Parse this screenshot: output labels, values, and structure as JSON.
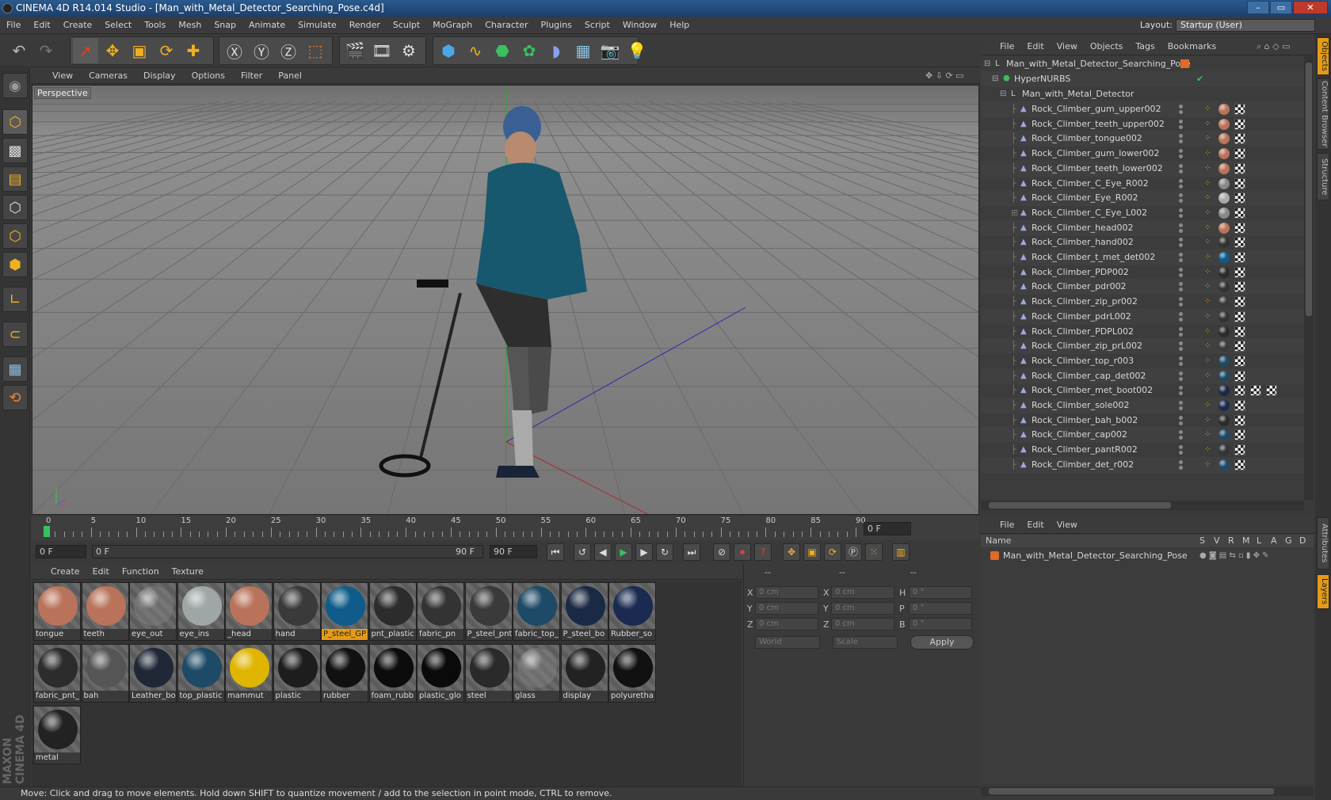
{
  "window": {
    "title": "CINEMA 4D R14.014 Studio - [Man_with_Metal_Detector_Searching_Pose.c4d]",
    "minimize": "–",
    "maximize": "▭",
    "close": "✕"
  },
  "menubar": {
    "items": [
      "File",
      "Edit",
      "Create",
      "Select",
      "Tools",
      "Mesh",
      "Snap",
      "Animate",
      "Simulate",
      "Render",
      "Sculpt",
      "MoGraph",
      "Character",
      "Plugins",
      "Script",
      "Window",
      "Help"
    ],
    "layout_label": "Layout:",
    "layout_value": "Startup (User)"
  },
  "viewport": {
    "menu": [
      "View",
      "Cameras",
      "Display",
      "Options",
      "Filter",
      "Panel"
    ],
    "label": "Perspective"
  },
  "timeline": {
    "ticks": [
      "0",
      "5",
      "10",
      "15",
      "20",
      "25",
      "30",
      "35",
      "40",
      "45",
      "50",
      "55",
      "60",
      "65",
      "70",
      "75",
      "80",
      "85",
      "90"
    ],
    "current_frame_field": "0 F",
    "start_field": "0 F",
    "range_start": "0 F",
    "range_end": "90 F",
    "end_field": "90 F"
  },
  "materials": {
    "menu": [
      "Create",
      "Edit",
      "Function",
      "Texture"
    ],
    "items": [
      {
        "name": "tongue",
        "color": "#b9735a"
      },
      {
        "name": "teeth",
        "color": "#b9735a"
      },
      {
        "name": "eye_out",
        "color": "transparent"
      },
      {
        "name": "eye_ins",
        "color": "#9ea6a6"
      },
      {
        "name": "_head",
        "color": "#b9735a"
      },
      {
        "name": "hand",
        "color": "#3a3a3a"
      },
      {
        "name": "P_steel_GP",
        "color": "#0f5c8a"
      },
      {
        "name": "pnt_plastic",
        "color": "#2c2c2c"
      },
      {
        "name": "fabric_pn",
        "color": "#333"
      },
      {
        "name": "P_steel_pnt",
        "color": "#3a3a3a"
      },
      {
        "name": "fabric_top_",
        "color": "#1d4a66"
      },
      {
        "name": "P_steel_bo",
        "color": "#1a2a44"
      },
      {
        "name": "Rubber_so",
        "color": "#1b2a50"
      },
      {
        "name": "fabric_pnt_",
        "color": "#2c2c2c"
      },
      {
        "name": "bah",
        "color": "#555"
      },
      {
        "name": "Leather_bo",
        "color": "#202838"
      },
      {
        "name": "top_plastic",
        "color": "#1d4a66"
      },
      {
        "name": "mammut",
        "color": "#e0b500"
      },
      {
        "name": "plastic",
        "color": "#1d1d1d"
      },
      {
        "name": "rubber",
        "color": "#111"
      },
      {
        "name": "foam_rubb",
        "color": "#0c0c0c"
      },
      {
        "name": "plastic_glo",
        "color": "#0a0a0a"
      },
      {
        "name": "steel",
        "color": "#2a2a2a"
      },
      {
        "name": "glass",
        "color": "transparent"
      },
      {
        "name": "display",
        "color": "#222"
      },
      {
        "name": "polyuretha",
        "color": "#111"
      },
      {
        "name": "metal",
        "color": "#222"
      }
    ],
    "selected": "P_steel_GP"
  },
  "coords": {
    "header": [
      "--",
      "--",
      "--"
    ],
    "rows": [
      {
        "a": "X",
        "av": "0 cm",
        "b": "X",
        "bv": "0 cm",
        "c": "H",
        "cv": "0 °"
      },
      {
        "a": "Y",
        "av": "0 cm",
        "b": "Y",
        "bv": "0 cm",
        "c": "P",
        "cv": "0 °"
      },
      {
        "a": "Z",
        "av": "0 cm",
        "b": "Z",
        "bv": "0 cm",
        "c": "B",
        "cv": "0 °"
      }
    ],
    "world": "World",
    "scale": "Scale",
    "apply": "Apply"
  },
  "status": "Move: Click and drag to move elements. Hold down SHIFT to quantize movement / add to the selection in point mode, CTRL to remove.",
  "object_manager": {
    "menu": [
      "File",
      "Edit",
      "View",
      "Objects",
      "Tags",
      "Bookmarks"
    ],
    "root": "Man_with_Metal_Detector_Searching_Pose",
    "hypernurbs": "HyperNURBS",
    "group": "Man_with_Metal_Detector",
    "objects": [
      "Rock_Climber_gum_upper002",
      "Rock_Climber_teeth_upper002",
      "Rock_Climber_tongue002",
      "Rock_Climber_gum_lower002",
      "Rock_Climber_teeth_lower002",
      "Rock_Climber_C_Eye_R002",
      "Rock_Climber_Eye_R002",
      "Rock_Climber_C_Eye_L002",
      "Rock_Climber_head002",
      "Rock_Climber_hand002",
      "Rock_Climber_t_met_det002",
      "Rock_Climber_PDP002",
      "Rock_Climber_pdr002",
      "Rock_Climber_zip_pr002",
      "Rock_Climber_pdrL002",
      "Rock_Climber_PDPL002",
      "Rock_Climber_zip_prL002",
      "Rock_Climber_top_r003",
      "Rock_Climber_cap_det002",
      "Rock_Climber_met_boot002",
      "Rock_Climber_sole002",
      "Rock_Climber_bah_b002",
      "Rock_Climber_cap002",
      "Rock_Climber_pantR002",
      "Rock_Climber_det_r002"
    ],
    "tag_colors": [
      "#b9735a",
      "#b9735a",
      "#b9735a",
      "#b9735a",
      "#b9735a",
      "#888",
      "#aaa",
      "#888",
      "#b9735a",
      "#333",
      "#0f5c8a",
      "#2c2c2c",
      "#333",
      "#3a3a3a",
      "#333",
      "#2c2c2c",
      "#3a3a3a",
      "#1d4a66",
      "#1d4a66",
      "#1a2a44",
      "#1b2a50",
      "#2c2c2c",
      "#1d4a66",
      "#333",
      "#1d4a66"
    ]
  },
  "layer_manager": {
    "menu": [
      "File",
      "Edit",
      "View"
    ],
    "columns": [
      "Name",
      "S",
      "V",
      "R",
      "M",
      "L",
      "A",
      "G",
      "D"
    ],
    "layer": "Man_with_Metal_Detector_Searching_Pose"
  },
  "vtabs": [
    "Objects",
    "Content Browser",
    "Structure",
    "Attributes",
    "Layers"
  ],
  "brand": "MAXON CINEMA 4D"
}
